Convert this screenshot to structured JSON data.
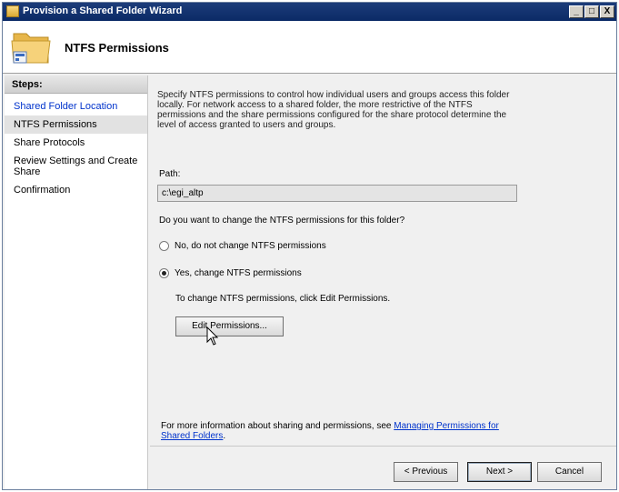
{
  "window": {
    "title": "Provision a Shared Folder Wizard",
    "controls": [
      "_",
      "□",
      "X"
    ]
  },
  "header": {
    "title": "NTFS Permissions",
    "icon": "folder-icon"
  },
  "steps": {
    "heading": "Steps:",
    "items": [
      {
        "label": "Shared Folder Location",
        "state": "completed"
      },
      {
        "label": "NTFS Permissions",
        "state": "current"
      },
      {
        "label": "Share Protocols",
        "state": "pending"
      },
      {
        "label": "Review Settings and Create Share",
        "state": "pending"
      },
      {
        "label": "Confirmation",
        "state": "pending"
      }
    ]
  },
  "main": {
    "description": "Specify NTFS permissions to control how individual users and groups access this folder locally. For network access to a shared folder, the more restrictive of the NTFS permissions and the share permissions configured for the share protocol determine the level of access granted to users and groups.",
    "path_label": "Path:",
    "path_value": "c:\\egi_altp",
    "question": "Do you want to change the NTFS permissions for this folder?",
    "option_no": "No, do not change NTFS permissions",
    "option_yes": "Yes, change NTFS permissions",
    "selected_option": "yes",
    "hint": "To change NTFS permissions, click Edit Permissions.",
    "edit_button": "Edit Permissions...",
    "more_info_prefix": "For more information about sharing and permissions, see ",
    "more_info_link": "Managing Permissions for Shared Folders",
    "more_info_suffix": "."
  },
  "footer": {
    "previous": "< Previous",
    "next": "Next >",
    "cancel": "Cancel"
  }
}
